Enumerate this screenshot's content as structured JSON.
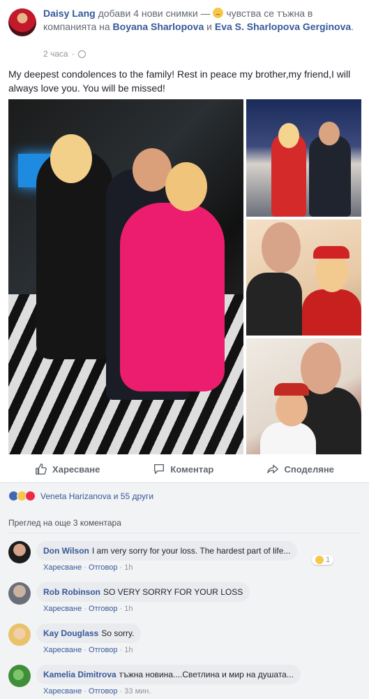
{
  "post": {
    "author": "Daisy Lang",
    "action": "добави 4 нови снимки —",
    "feeling": "чувства се тъжна в компанията на",
    "tag1": "Boyana Sharlopova",
    "and": "и",
    "tag2": "Eva S. Sharlopova Gerginova",
    "period": ".",
    "time": "2 часа",
    "dot": "·",
    "text": "My deepest condolences to the family! Rest in peace my brother,my friend,I will always love you. You will be missed!"
  },
  "actions": {
    "like": "Харесване",
    "comment": "Коментар",
    "share": "Споделяне"
  },
  "reactions": {
    "summary": "Veneta Harizanova и 55 други",
    "colors": {
      "like": "#4267b2",
      "sad": "#f7c74a",
      "love": "#f0284a"
    }
  },
  "view_more": "Преглед на още 3 коментара",
  "comments": [
    {
      "name": "Don Wilson",
      "text": "I am very sorry for your loss. The hardest part of life...",
      "like": "Харесване",
      "sep": "·",
      "reply": "Отговор",
      "time": "1h",
      "reaction_count": "1"
    },
    {
      "name": "Rob Robinson",
      "text": "SO VERY SORRY FOR YOUR LOSS",
      "like": "Харесване",
      "sep": "·",
      "reply": "Отговор",
      "time": "1h"
    },
    {
      "name": "Kay Douglass",
      "text": "So sorry.",
      "like": "Харесване",
      "sep": "·",
      "reply": "Отговор",
      "time": "1h"
    },
    {
      "name": "Kamelia Dimitrova",
      "text": "тъжна новина....Светлина и мир на душата...",
      "like": "Харесване",
      "sep": "·",
      "reply": "Отговор",
      "time": "33 мин."
    }
  ],
  "colors": {
    "link": "#365899",
    "meta": "#90949c",
    "bubble": "#e9ebee"
  }
}
